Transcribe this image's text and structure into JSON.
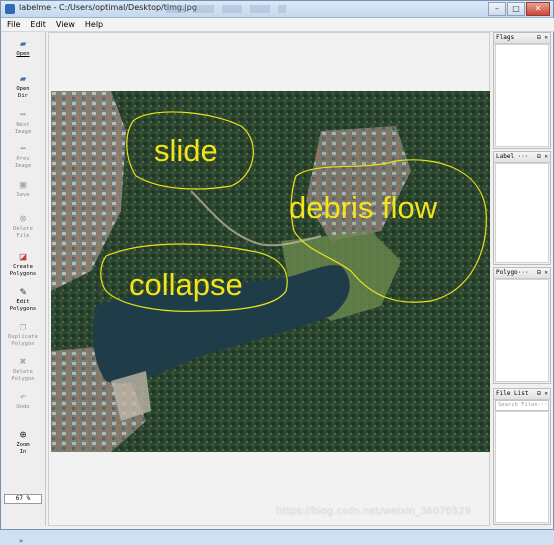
{
  "window": {
    "title": "labelme - C:/Users/optimal/Desktop/timg.jpg",
    "controls": {
      "minimize": "–",
      "maximize": "□",
      "close": "✕"
    }
  },
  "menu": [
    "File",
    "Edit",
    "View",
    "Help"
  ],
  "toolbar": {
    "open": {
      "label": "Open",
      "icon": "open-icon"
    },
    "open_dir": {
      "label1": "Open",
      "label2": "Dir",
      "icon": "folder-icon"
    },
    "next_image": {
      "label1": "Next",
      "label2": "Image",
      "icon": "arrow-right-icon"
    },
    "prev_image": {
      "label1": "Prev",
      "label2": "Image",
      "icon": "arrow-left-icon"
    },
    "save": {
      "label": "Save",
      "icon": "save-icon"
    },
    "delete_file": {
      "label1": "Delete",
      "label2": "File",
      "icon": "delete-icon"
    },
    "create_polygons": {
      "label1": "Create",
      "label2": "Polygons",
      "icon": "polygon-create-icon"
    },
    "edit_polygons": {
      "label1": "Edit",
      "label2": "Polygons",
      "icon": "edit-icon"
    },
    "duplicate_polygon": {
      "label1": "Duplicate",
      "label2": "Polygon",
      "icon": "duplicate-icon"
    },
    "delete_polygon": {
      "label1": "Delete",
      "label2": "Polygon",
      "icon": "cross-icon"
    },
    "undo": {
      "label": "Undo",
      "icon": "undo-icon"
    },
    "zoom_in": {
      "label1": "Zoom",
      "label2": "In",
      "icon": "zoom-in-icon"
    },
    "zoom_value": "67 %",
    "more": "»"
  },
  "canvas": {
    "annotations": {
      "slide": "slide",
      "debris_flow": "debris flow",
      "collapse": "collapse"
    },
    "colors": {
      "annotation_stroke": "#e6e21a",
      "water": "#1e3d48",
      "forest": "#27402a"
    }
  },
  "docks": {
    "flags": {
      "title": "Flags",
      "ctrls": "⊟ ✕"
    },
    "label_list": {
      "title": "Label ···",
      "ctrls": "⊟ ✕"
    },
    "polygon_labels": {
      "title": "Polygo···",
      "ctrls": "⊟ ✕"
    },
    "file_list": {
      "title": "File List",
      "ctrls": "⊟ ✕",
      "search_placeholder": "Search Filen···"
    }
  },
  "watermark": "https://blog.csdn.net/weixin_36070529"
}
